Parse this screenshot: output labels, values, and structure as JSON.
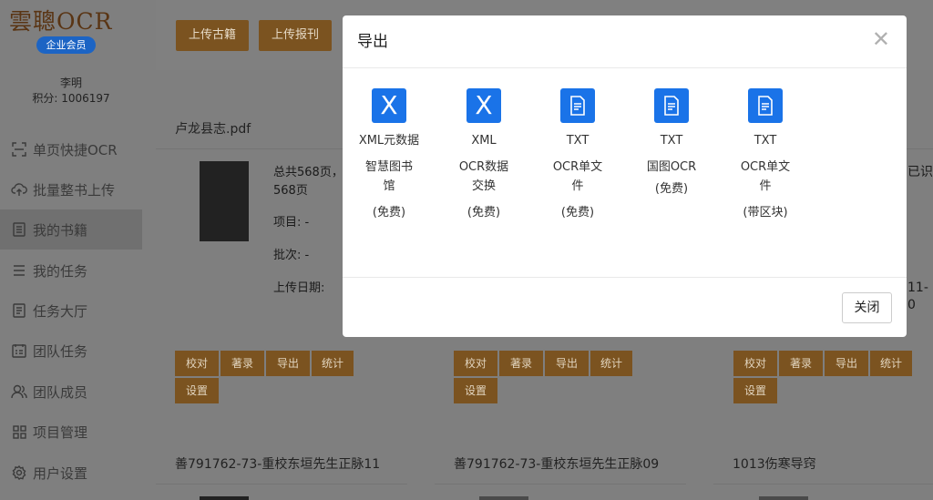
{
  "sidebar": {
    "logo": "雲聰OCR",
    "badge": "企业会员",
    "user_name": "李明",
    "user_points": "积分: 1006197",
    "items": [
      {
        "label": "单页快捷OCR",
        "icon": "scan-icon"
      },
      {
        "label": "批量整书上传",
        "icon": "cloud-upload-icon"
      },
      {
        "label": "我的书籍",
        "icon": "book-icon"
      },
      {
        "label": "我的任务",
        "icon": "list-icon"
      },
      {
        "label": "任务大厅",
        "icon": "document-icon"
      },
      {
        "label": "团队任务",
        "icon": "checklist-icon"
      },
      {
        "label": "团队成员",
        "icon": "users-icon"
      },
      {
        "label": "项目管理",
        "icon": "grid-icon"
      },
      {
        "label": "用户设置",
        "icon": "gear-icon"
      }
    ]
  },
  "toolbar": {
    "upload_book": "上传古籍",
    "upload_periodical": "上传报刊"
  },
  "cards": [
    {
      "title": "卢龙县志.pdf",
      "total_line1": "总共568页，",
      "total_line2": "568页",
      "project": "项目:  -",
      "batch": "批次:  -",
      "upload_date": "上传日期:"
    },
    {
      "title": ""
    },
    {
      "title": "",
      "fragment": "已识",
      "date_fragment": "11-0"
    }
  ],
  "card_actions": [
    "校对",
    "著录",
    "导出",
    "统计",
    "设置"
  ],
  "bottom_cards": [
    "善791762-73-重校东垣先生正脉11",
    "善791762-73-重校东垣先生正脉09",
    "1013伤寒导窍"
  ],
  "modal": {
    "title": "导出",
    "close_label": "关闭",
    "options": [
      {
        "icon": "X",
        "format": "XML元数据",
        "desc": "智慧图书馆",
        "price": "(免费)"
      },
      {
        "icon": "X",
        "format": "XML",
        "desc": "OCR数据交换",
        "price": "(免费)"
      },
      {
        "icon": "doc",
        "format": "TXT",
        "desc": "OCR单文件",
        "price": "(免费)"
      },
      {
        "icon": "doc",
        "format": "TXT",
        "desc": "国图OCR",
        "price": "(免费)"
      },
      {
        "icon": "doc",
        "format": "TXT",
        "desc": "OCR单文件",
        "price": "(带区块)"
      }
    ]
  }
}
